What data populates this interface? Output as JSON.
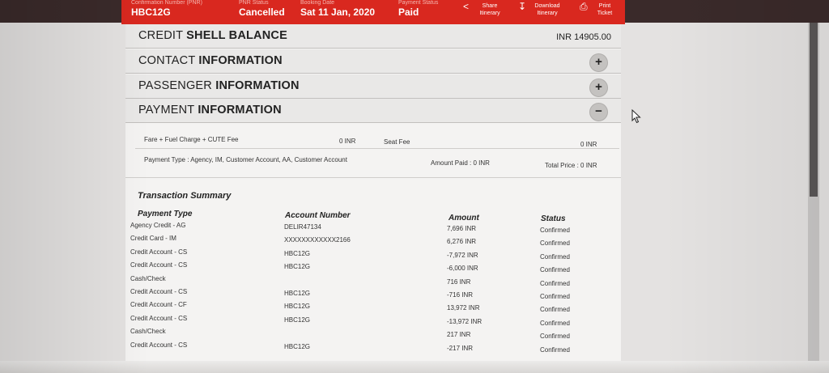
{
  "header": {
    "pnr_label": "Confirmation Number (PNR)",
    "pnr_value": "HBC12G",
    "status_label": "PNR Status",
    "status_value": "Cancelled",
    "date_label": "Booking Date",
    "date_value": "Sat 11 Jan, 2020",
    "payment_label": "Payment Status",
    "payment_value": "Paid",
    "share_label1": "Share",
    "share_label2": "Itinerary",
    "download_label1": "Download",
    "download_label2": "Itinerary",
    "print_label1": "Print",
    "print_label2": "Ticket"
  },
  "sections": {
    "credit": {
      "title_light": "CREDIT",
      "title_bold": "SHELL BALANCE",
      "value": "INR 14905.00"
    },
    "contact": {
      "title_light": "CONTACT",
      "title_bold": "INFORMATION",
      "toggle": "+"
    },
    "passenger": {
      "title_light": "PASSENGER",
      "title_bold": "INFORMATION",
      "toggle": "+"
    },
    "payment": {
      "title_light": "PAYMENT",
      "title_bold": "INFORMATION",
      "toggle": "−"
    }
  },
  "payment_info": {
    "fare_label": "Fare + Fuel Charge + CUTE Fee",
    "fare_value": "0 INR",
    "seat_label": "Seat Fee",
    "seat_value": "0 INR",
    "payment_type": "Payment Type : Agency, IM, Customer Account, AA, Customer Account",
    "amount_paid": "Amount Paid : 0 INR",
    "total_price": "Total Price : 0 INR"
  },
  "transactions": {
    "title": "Transaction Summary",
    "headers": [
      "Payment Type",
      "Account Number",
      "Amount",
      "Status"
    ],
    "rows": [
      [
        "Agency Credit  -  AG",
        "DELIR47134",
        "7,696 INR",
        "Confirmed"
      ],
      [
        "Credit Card -  IM",
        "XXXXXXXXXXXX2166",
        "6,276 INR",
        "Confirmed"
      ],
      [
        "Credit Account  -  CS",
        "HBC12G",
        "-7,972 INR",
        "Confirmed"
      ],
      [
        "Credit Account  -  CS",
        "HBC12G",
        "-6,000 INR",
        "Confirmed"
      ],
      [
        "Cash/Check",
        "",
        "716 INR",
        "Confirmed"
      ],
      [
        "Credit Account  -  CS",
        "HBC12G",
        "-716 INR",
        "Confirmed"
      ],
      [
        "Credit Account  -  CF",
        "HBC12G",
        "13,972 INR",
        "Confirmed"
      ],
      [
        "Credit Account  -  CS",
        "HBC12G",
        "-13,972 INR",
        "Confirmed"
      ],
      [
        "Cash/Check",
        "",
        "217 INR",
        "Confirmed"
      ],
      [
        "Credit Account  -  CS",
        "HBC12G",
        "-217 INR",
        "Confirmed"
      ]
    ]
  }
}
